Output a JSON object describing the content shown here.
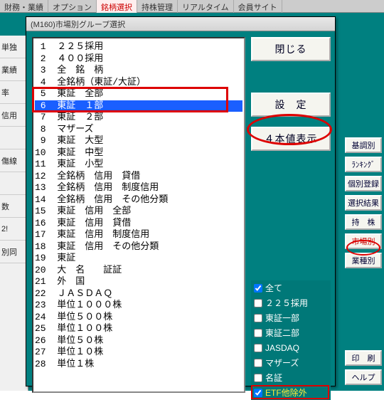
{
  "bg": {
    "tabs": [
      "財務・業績",
      "オプション",
      "銘柄選択",
      "持株管理",
      "リアルタイム",
      "会員サイト"
    ],
    "leftLabels": [
      "単独",
      "業績",
      "率",
      "信用",
      "",
      "傷線",
      "",
      "数",
      "2!",
      "別同"
    ],
    "sideButtons": [
      {
        "label": "基調別"
      },
      {
        "label": "ﾗﾝｷﾝｸﾞ"
      },
      {
        "label": "個別登録"
      },
      {
        "label": "選択結果"
      },
      {
        "label": "持　株"
      },
      {
        "label": "市場別",
        "red": true
      },
      {
        "label": "業種別"
      },
      {
        "label": "印　刷",
        "gap": true
      },
      {
        "label": "ヘルプ"
      }
    ]
  },
  "dialog": {
    "title": "(M160)市場別グループ選択",
    "list": [
      " 1  ２２５採用",
      " 2  ４００採用",
      " 3  全　銘　柄",
      " 4  全銘柄（東証/大証）",
      " 5  東証　全部",
      " 6  東証　１部",
      " 7  東証　２部",
      " 8  マザーズ",
      " 9  東証　大型",
      "10  東証　中型",
      "11  東証　小型",
      "12  全銘柄　信用　貸借",
      "13  全銘柄　信用　制度信用",
      "14  全銘柄　信用　その他分類",
      "15  東証　信用　全部",
      "16  東証　信用　貸借",
      "17  東証　信用　制度信用",
      "18  東証　信用　その他分類",
      "19  東証",
      "20  大　名　　証証",
      "21  外　国",
      "22  ＪＡＳＤＡＱ",
      "23  単位１０００株",
      "24  単位５００株",
      "25  単位１００株",
      "26  単位５０株",
      "27  単位１０株",
      "28  単位１株"
    ],
    "selectedIndex": 5,
    "buttons": {
      "close": "閉じる",
      "set": "設　定",
      "fourVal": "４本値表示"
    },
    "checks": [
      {
        "label": "全て",
        "checked": true,
        "yellow": false
      },
      {
        "label": "２２５採用",
        "checked": false,
        "yellow": false
      },
      {
        "label": "東証一部",
        "checked": false,
        "yellow": false
      },
      {
        "label": "東証二部",
        "checked": false,
        "yellow": false
      },
      {
        "label": "JASDAQ",
        "checked": false,
        "yellow": false
      },
      {
        "label": "マザーズ",
        "checked": false,
        "yellow": false
      },
      {
        "label": "名証",
        "checked": false,
        "yellow": false
      },
      {
        "label": "ETF他除外",
        "checked": true,
        "yellow": true
      }
    ]
  }
}
